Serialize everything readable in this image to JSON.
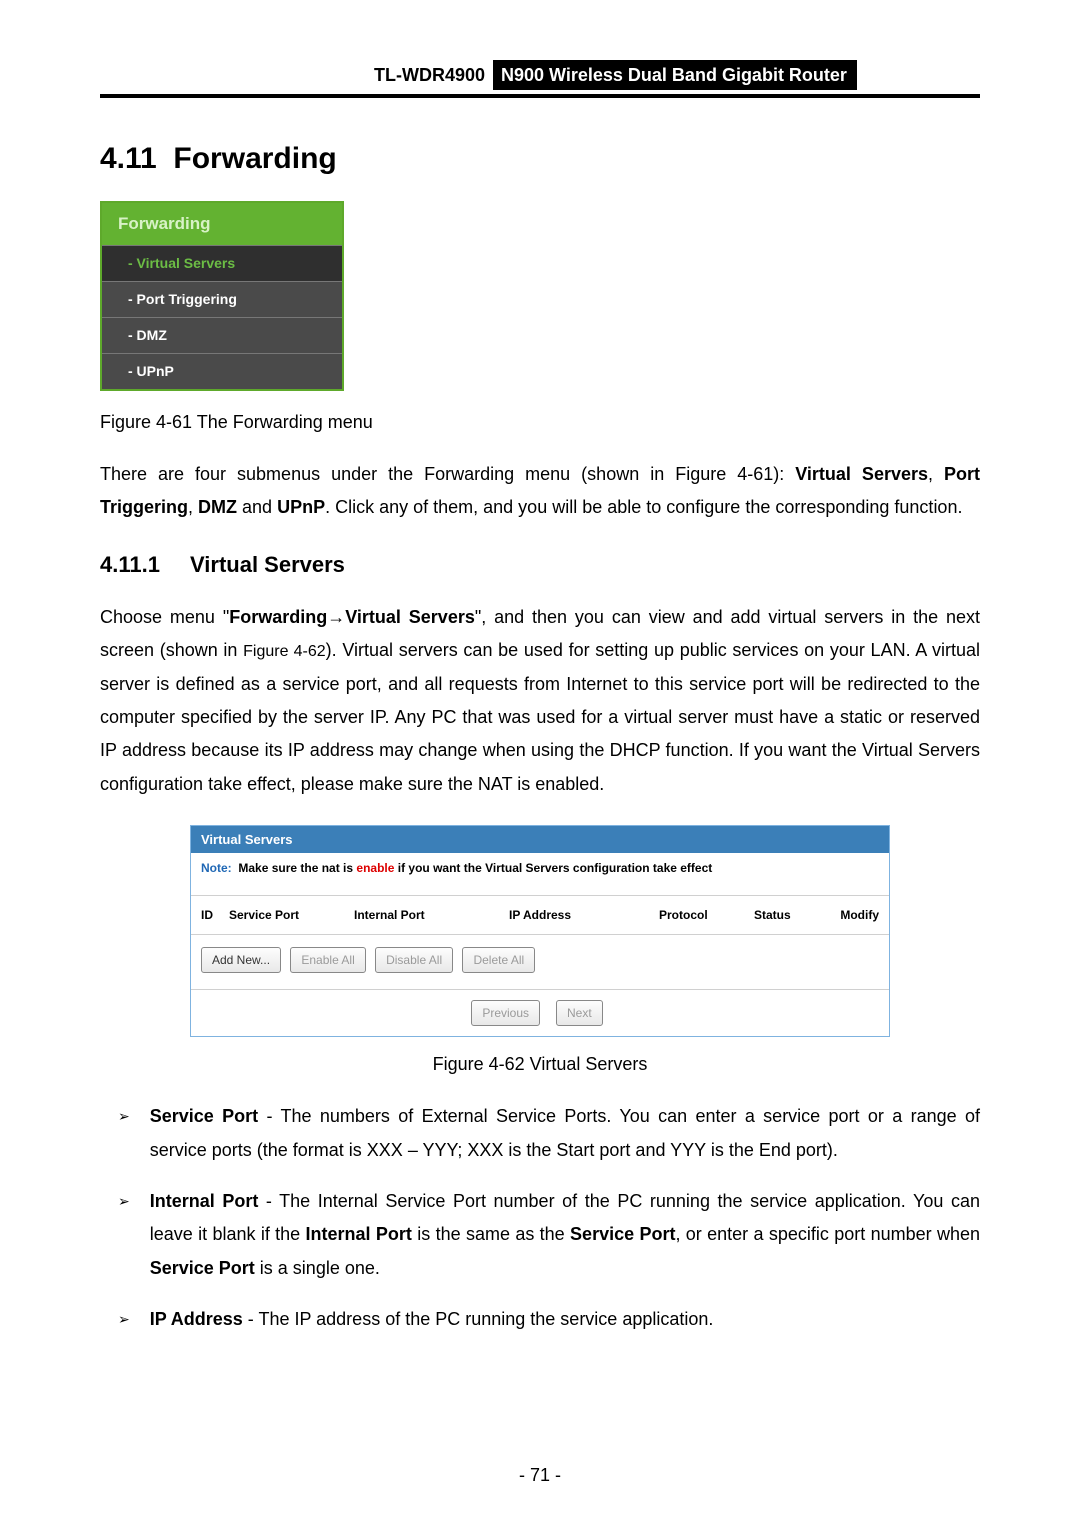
{
  "header": {
    "model": "TL-WDR4900",
    "product": "N900 Wireless Dual Band Gigabit Router"
  },
  "section": {
    "number": "4.11",
    "title": "Forwarding"
  },
  "menu": {
    "header": "Forwarding",
    "items": [
      {
        "label": "- Virtual Servers",
        "active": true
      },
      {
        "label": "- Port Triggering",
        "active": false
      },
      {
        "label": "- DMZ",
        "active": false
      },
      {
        "label": "- UPnP",
        "active": false
      }
    ]
  },
  "fig61": "Figure 4-61 The Forwarding menu",
  "intro": {
    "p1a": "There are four submenus under the Forwarding menu (shown in Figure 4-61): ",
    "vs": "Virtual Servers",
    "p1b": ", ",
    "pt": "Port Triggering",
    "p1c": ", ",
    "dmz": "DMZ",
    "p1d": " and ",
    "upnp": "UPnP",
    "p1e": ". Click any of them, and you will be able to configure the corresponding function."
  },
  "subsection": {
    "number": "4.11.1",
    "title": "Virtual Servers"
  },
  "para2": {
    "a": "Choose menu \"",
    "b": "Forwarding",
    "arrow": "→",
    "c": "Virtual Servers",
    "d": "\", and then you can view and add virtual servers in the next screen (shown in ",
    "figref": "Figure 4-62",
    "e": "). Virtual servers can be used for setting up public services on your LAN. A virtual server is defined as a service port, and all requests from Internet to this service port will be redirected to the computer specified by the server IP. Any PC that was used for a virtual server must have a static or reserved IP address because its IP address may change when using the DHCP function. If you want the Virtual Servers configuration take effect, please make sure the NAT is enabled."
  },
  "panel": {
    "title": "Virtual Servers",
    "note_label": "Note:",
    "note_pre": "Make sure the nat is ",
    "note_enable": "enable",
    "note_post": " if you want the Virtual Servers configuration take effect",
    "cols": {
      "id": "ID",
      "service_port": "Service Port",
      "internal_port": "Internal Port",
      "ip_address": "IP Address",
      "protocol": "Protocol",
      "status": "Status",
      "modify": "Modify"
    },
    "buttons": {
      "add_new": "Add New...",
      "enable_all": "Enable All",
      "disable_all": "Disable All",
      "delete_all": "Delete All",
      "previous": "Previous",
      "next": "Next"
    }
  },
  "fig62": "Figure 4-62 Virtual Servers",
  "defs": {
    "sp_label": "Service Port",
    "sp_text": " - The numbers of External Service Ports. You can enter a service port or a range of service ports (the format is XXX – YYY; XXX is the Start port and YYY is the End port).",
    "ip_label_a": "Internal Port",
    "ip_text_a": " - The Internal Service Port number of the PC running the service application. You can leave it blank if the ",
    "ip_bold_b": "Internal Port",
    "ip_text_b": " is the same as the ",
    "ip_bold_c": "Service Port",
    "ip_text_c": ", or enter a specific port number when ",
    "ip_bold_d": "Service Port",
    "ip_text_d": " is a single one.",
    "addr_label": "IP Address",
    "addr_text": " - The IP address of the PC running the service application."
  },
  "page_number": "- 71 -"
}
